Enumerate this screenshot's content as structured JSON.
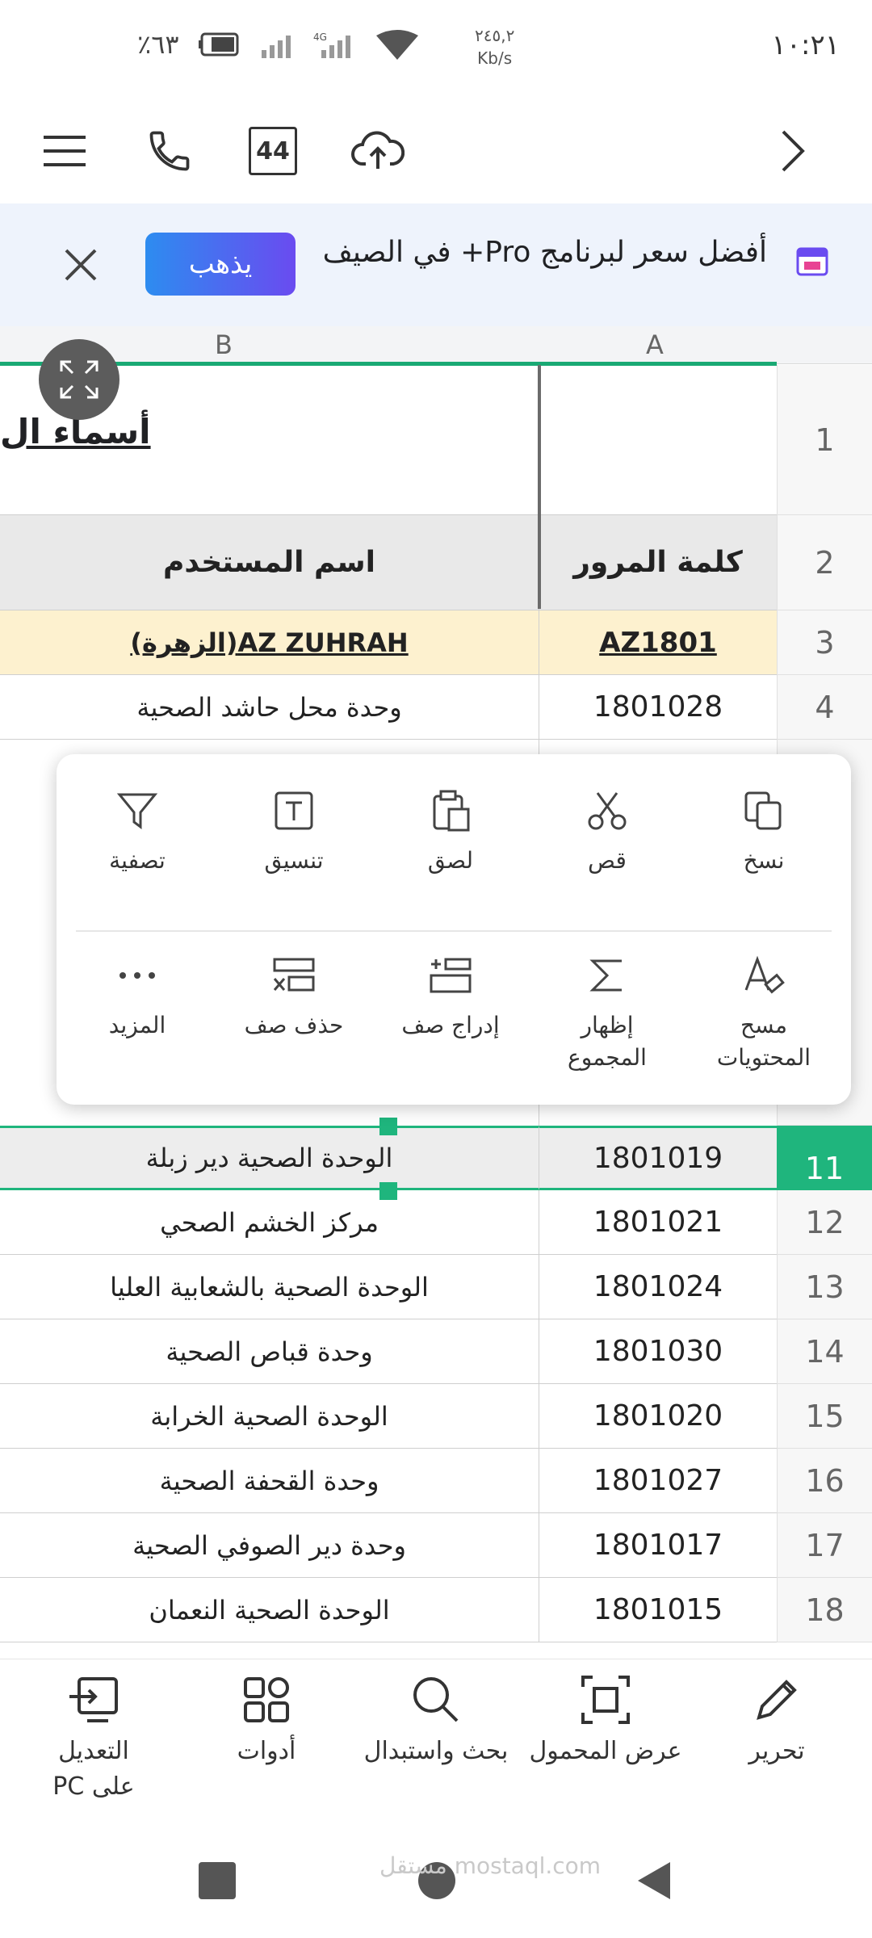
{
  "status": {
    "time": "١٠:٢١",
    "battery_pct": "٪٦٣",
    "speed_value": "٢٤٥,٢",
    "speed_unit": "Kb/s",
    "network": "4G"
  },
  "toolbar": {
    "tab_count": "44"
  },
  "banner": {
    "message": "أفضل سعر لبرنامج Pro+ في الصيف",
    "go_label": "يذهب"
  },
  "sheet": {
    "col_a": "A",
    "col_b": "B",
    "title_text": "أسماء ال",
    "header_password": "كلمة المرور",
    "header_username": "اسم المستخدم",
    "rows": [
      {
        "num": "1",
        "a": "",
        "b": ""
      },
      {
        "num": "2",
        "a": "كلمة المرور",
        "b": "اسم المستخدم"
      },
      {
        "num": "3",
        "a": "AZ1801",
        "b": "AZ ZUHRAH(الزهرة)"
      },
      {
        "num": "4",
        "a": "1801028",
        "b": "وحدة محل حاشد الصحية"
      },
      {
        "num": "11",
        "a": "1801019",
        "b": "الوحدة الصحية دير زبلة"
      },
      {
        "num": "12",
        "a": "1801021",
        "b": "مركز الخشم الصحي"
      },
      {
        "num": "13",
        "a": "1801024",
        "b": "الوحدة الصحية بالشعابية العليا"
      },
      {
        "num": "14",
        "a": "1801030",
        "b": "وحدة قباص الصحية"
      },
      {
        "num": "15",
        "a": "1801020",
        "b": "الوحدة الصحية الخرابة"
      },
      {
        "num": "16",
        "a": "1801027",
        "b": "وحدة القحفة الصحية"
      },
      {
        "num": "17",
        "a": "1801017",
        "b": "وحدة دير الصوفي الصحية"
      },
      {
        "num": "18",
        "a": "1801015",
        "b": "الوحدة الصحية النعمان"
      }
    ]
  },
  "context_menu": {
    "copy": "نسخ",
    "cut": "قص",
    "paste": "لصق",
    "format": "تنسيق",
    "filter": "تصفية",
    "clear_contents": "مسح المحتويات",
    "show_sum": "إظهار المجموع",
    "insert_row": "إدراج صف",
    "delete_row": "حذف صف",
    "more": "المزيد"
  },
  "bottom_bar": {
    "edit": "تحرير",
    "mobile_view": "عرض المحمول",
    "find_replace": "بحث واستبدال",
    "tools": "أدوات",
    "edit_on_pc": "التعديل على PC"
  },
  "watermark": "مستقل mostaql.com"
}
